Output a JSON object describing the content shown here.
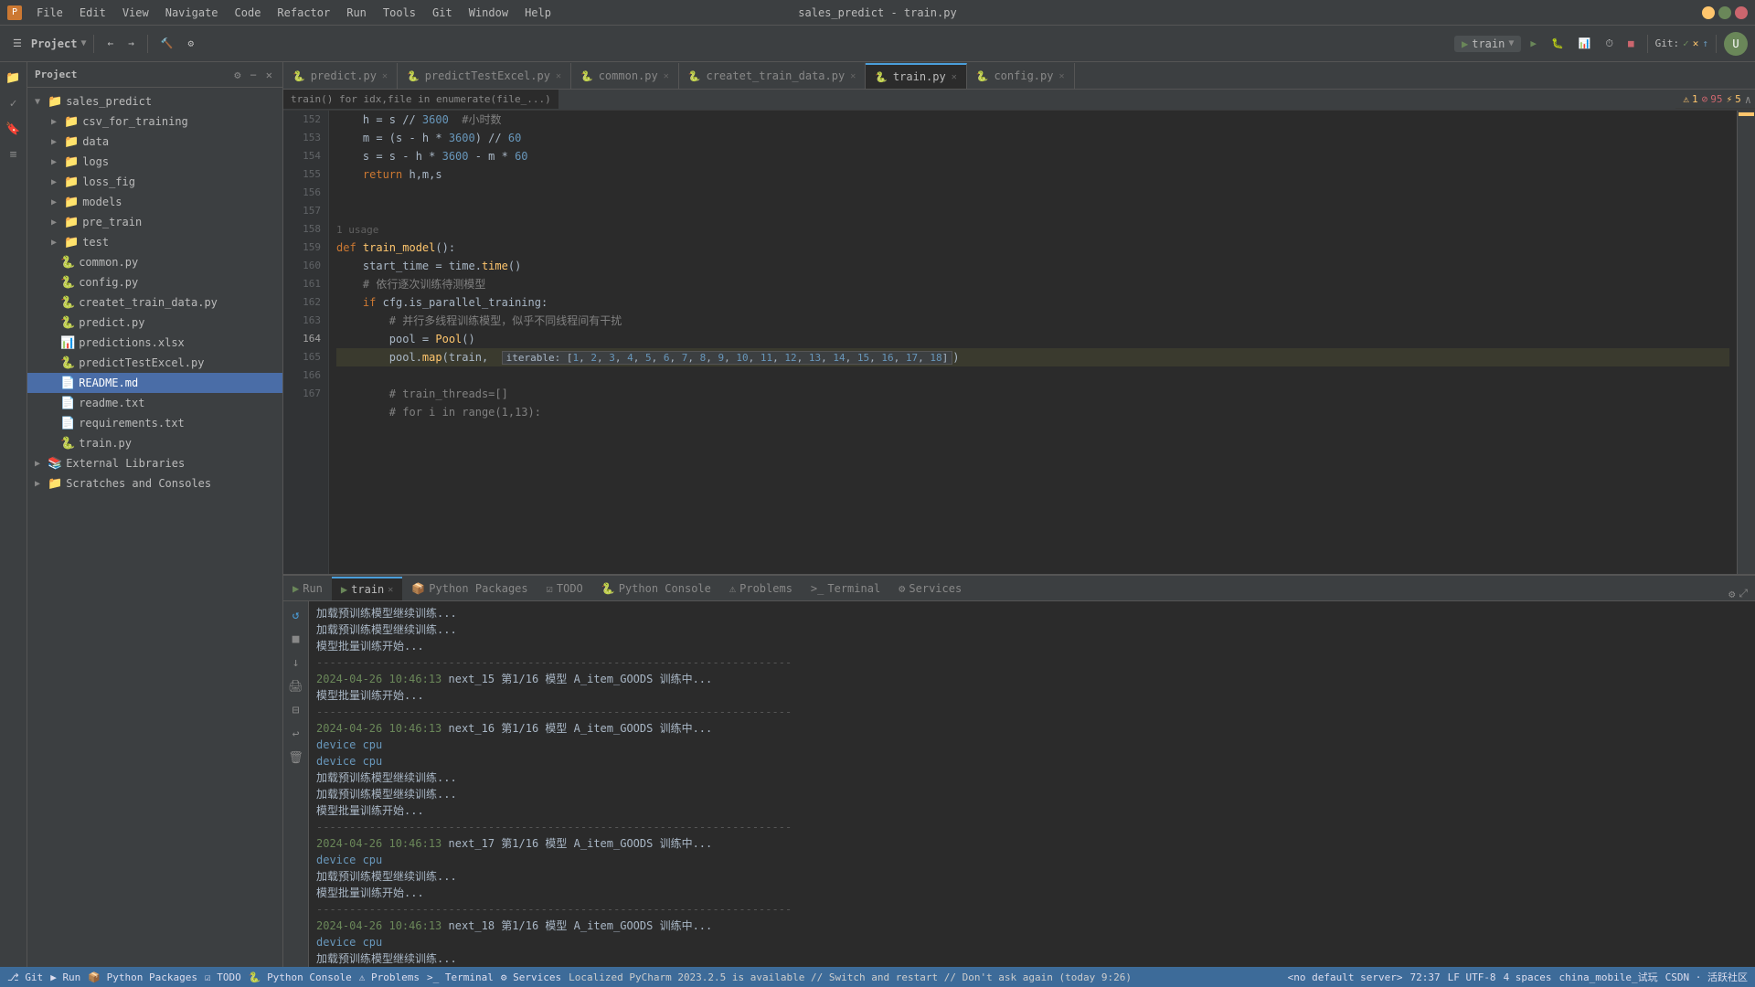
{
  "window": {
    "title": "sales_predict - train.py",
    "min": "—",
    "max": "□",
    "close": "✕"
  },
  "menus": [
    "File",
    "Edit",
    "View",
    "Navigate",
    "Code",
    "Refactor",
    "Run",
    "Tools",
    "Git",
    "Window",
    "Help"
  ],
  "project_name": "sales_predict",
  "active_file": "train.py",
  "toolbar": {
    "project_label": "Project",
    "run_config": "train",
    "git_label": "Git:",
    "git_status": "✓ ✕ ↑"
  },
  "tabs": [
    {
      "label": "predict.py",
      "active": false,
      "modified": false
    },
    {
      "label": "predictTestExcel.py",
      "active": false,
      "modified": false
    },
    {
      "label": "common.py",
      "active": false,
      "modified": false
    },
    {
      "label": "createt_train_data.py",
      "active": false,
      "modified": false
    },
    {
      "label": "train.py",
      "active": true,
      "modified": false
    },
    {
      "label": "config.py",
      "active": false,
      "modified": false
    }
  ],
  "breadcrumb": "train()   for idx,file in enumerate(file_...)",
  "sidebar": {
    "title": "Project",
    "root": "sales_predict",
    "root_path": "D/git/ai/sales_predict",
    "items": [
      {
        "label": "csv_for_training",
        "type": "folder",
        "depth": 1,
        "expanded": false
      },
      {
        "label": "data",
        "type": "folder",
        "depth": 1,
        "expanded": false
      },
      {
        "label": "logs",
        "type": "folder",
        "depth": 1,
        "expanded": false
      },
      {
        "label": "loss_fig",
        "type": "folder",
        "depth": 1,
        "expanded": false
      },
      {
        "label": "models",
        "type": "folder",
        "depth": 1,
        "expanded": false
      },
      {
        "label": "pre_train",
        "type": "folder",
        "depth": 1,
        "expanded": false
      },
      {
        "label": "test",
        "type": "folder",
        "depth": 1,
        "expanded": false
      },
      {
        "label": "common.py",
        "type": "py",
        "depth": 2
      },
      {
        "label": "config.py",
        "type": "py",
        "depth": 2
      },
      {
        "label": "createt_train_data.py",
        "type": "py",
        "depth": 2
      },
      {
        "label": "predict.py",
        "type": "py",
        "depth": 2
      },
      {
        "label": "predictions.xlsx",
        "type": "xlsx",
        "depth": 2
      },
      {
        "label": "predictTestExcel.py",
        "type": "py",
        "depth": 2
      },
      {
        "label": "README.md",
        "type": "md",
        "depth": 2,
        "selected": true
      },
      {
        "label": "readme.txt",
        "type": "txt",
        "depth": 2
      },
      {
        "label": "requirements.txt",
        "type": "txt",
        "depth": 2
      },
      {
        "label": "train.py",
        "type": "py",
        "depth": 2
      },
      {
        "label": "External Libraries",
        "type": "folder",
        "depth": 0
      },
      {
        "label": "Scratches and Consoles",
        "type": "folder",
        "depth": 0
      }
    ]
  },
  "code_lines": [
    {
      "num": 152,
      "text": "    h = s // 3600  #小时数",
      "tokens": [
        {
          "t": "var",
          "v": "    h = s // 3600  "
        },
        {
          "t": "cm",
          "v": "#小时数"
        }
      ]
    },
    {
      "num": 153,
      "text": "    m = (s - h * 3600) // 60",
      "tokens": [
        {
          "t": "var",
          "v": "    m = (s - h * "
        },
        {
          "t": "num",
          "v": "3600"
        },
        {
          "t": "var",
          "v": ") // "
        },
        {
          "t": "num",
          "v": "60"
        }
      ]
    },
    {
      "num": 154,
      "text": "    s = s - h * 3600 - m * 60",
      "tokens": [
        {
          "t": "var",
          "v": "    s = s - h * "
        },
        {
          "t": "num",
          "v": "3600"
        },
        {
          "t": "var",
          "v": " - m * "
        },
        {
          "t": "num",
          "v": "60"
        }
      ]
    },
    {
      "num": 155,
      "text": "    return h,m,s",
      "tokens": [
        {
          "t": "kw",
          "v": "    return "
        },
        {
          "t": "var",
          "v": "h,m,s"
        }
      ]
    },
    {
      "num": 156,
      "text": "",
      "tokens": []
    },
    {
      "num": 157,
      "text": "",
      "tokens": []
    },
    {
      "num": 158,
      "text": "1 usage\ndef train_model():",
      "tokens": [
        {
          "t": "cm",
          "v": "1 usage"
        },
        {
          "t": "kw",
          "v": "\ndef "
        },
        {
          "t": "fn",
          "v": "train_model"
        },
        {
          "t": "var",
          "v": "():"
        }
      ]
    },
    {
      "num": 159,
      "text": "    start_time = time.time()",
      "tokens": [
        {
          "t": "var",
          "v": "    start_time = time."
        },
        {
          "t": "fn",
          "v": "time"
        },
        {
          "t": "var",
          "v": "()"
        }
      ]
    },
    {
      "num": 160,
      "text": "    # 依行逐次训练待测模型",
      "tokens": [
        {
          "t": "cm",
          "v": "    # 依行逐次训练待测模型"
        }
      ]
    },
    {
      "num": 161,
      "text": "    if cfg.is_parallel_training:",
      "tokens": [
        {
          "t": "var",
          "v": "    "
        },
        {
          "t": "kw",
          "v": "if "
        },
        {
          "t": "var",
          "v": "cfg.is_parallel_training:"
        }
      ]
    },
    {
      "num": 162,
      "text": "        # 并行多线程训练模型，似乎不同线程间有干扰",
      "tokens": [
        {
          "t": "cm",
          "v": "        # 并行多线程训练模型，似乎不同线程间有干扰"
        }
      ]
    },
    {
      "num": 163,
      "text": "        pool = Pool()",
      "tokens": [
        {
          "t": "var",
          "v": "        pool = "
        },
        {
          "t": "fn",
          "v": "Pool"
        },
        {
          "t": "var",
          "v": "()"
        }
      ]
    },
    {
      "num": 164,
      "text": "        pool.map(train,  iterable: [1, 2, 3, 4, 5, 6, 7, 8, 9, 10, 11, 12, 13, 14, 15, 16, 17, 18])",
      "tokens": [
        {
          "t": "var",
          "v": "        pool."
        },
        {
          "t": "fn",
          "v": "map"
        },
        {
          "t": "var",
          "v": "(train,  "
        },
        {
          "t": "cm",
          "v": "iterable: "
        },
        {
          "t": "var",
          "v": "["
        },
        {
          "t": "num",
          "v": "1"
        },
        {
          "t": "var",
          "v": ", "
        },
        {
          "t": "num",
          "v": "2"
        },
        {
          "t": "var",
          "v": ", "
        },
        {
          "t": "num",
          "v": "3"
        },
        {
          "t": "var",
          "v": ", "
        },
        {
          "t": "num",
          "v": "4"
        },
        {
          "t": "var",
          "v": ", "
        },
        {
          "t": "num",
          "v": "5"
        },
        {
          "t": "var",
          "v": ", "
        },
        {
          "t": "num",
          "v": "6"
        },
        {
          "t": "var",
          "v": ", "
        },
        {
          "t": "num",
          "v": "7"
        },
        {
          "t": "var",
          "v": ", "
        },
        {
          "t": "num",
          "v": "8"
        },
        {
          "t": "var",
          "v": ", "
        },
        {
          "t": "num",
          "v": "9"
        },
        {
          "t": "var",
          "v": ", "
        },
        {
          "t": "num",
          "v": "10"
        },
        {
          "t": "var",
          "v": ", "
        },
        {
          "t": "num",
          "v": "11"
        },
        {
          "t": "var",
          "v": ", "
        },
        {
          "t": "num",
          "v": "12"
        },
        {
          "t": "var",
          "v": ", "
        },
        {
          "t": "num",
          "v": "13"
        },
        {
          "t": "var",
          "v": ", "
        },
        {
          "t": "num",
          "v": "14"
        },
        {
          "t": "var",
          "v": ", "
        },
        {
          "t": "num",
          "v": "15"
        },
        {
          "t": "var",
          "v": ", "
        },
        {
          "t": "num",
          "v": "16"
        },
        {
          "t": "var",
          "v": ", "
        },
        {
          "t": "num",
          "v": "17"
        },
        {
          "t": "var",
          "v": ", "
        },
        {
          "t": "num",
          "v": "18"
        },
        {
          "t": "var",
          "v": "])"
        }
      ]
    },
    {
      "num": 165,
      "text": "",
      "tokens": []
    },
    {
      "num": 166,
      "text": "        # train_threads=[]",
      "tokens": [
        {
          "t": "cm",
          "v": "        # train_threads=[]"
        }
      ]
    },
    {
      "num": 167,
      "text": "        # for i in range(1,13):",
      "tokens": [
        {
          "t": "cm",
          "v": "        # for i in range(1,13):"
        }
      ]
    }
  ],
  "warnings": {
    "count": 1,
    "errors": 95,
    "warnings2": 5
  },
  "bottom_tabs": [
    {
      "label": "Run",
      "icon": "▶",
      "active": false
    },
    {
      "label": "train",
      "icon": "▶",
      "active": true
    },
    {
      "label": "Python Packages",
      "icon": "📦",
      "active": false
    },
    {
      "label": "TODO",
      "icon": "☑",
      "active": false
    },
    {
      "label": "Python Console",
      "icon": "🐍",
      "active": false
    },
    {
      "label": "Problems",
      "icon": "⚠",
      "active": false
    },
    {
      "label": "Terminal",
      "icon": ">_",
      "active": false
    },
    {
      "label": "Services",
      "icon": "⚙",
      "active": false
    }
  ],
  "console": {
    "lines": [
      "加载预训练模型继续训练...",
      "加载预训练模型继续训练...",
      "模型批量训练开始...",
      "------------------------------------------------------------------------",
      "2024-04-26 10:46:13 next_15 第1/16 模型 A_item_GOODS 训练中...",
      "模型批量训练开始...",
      "------------------------------------------------------------------------",
      "2024-04-26 10:46:13 next_16 第1/16 模型 A_item_GOODS 训练中...",
      "device cpu",
      "device cpu",
      "加载预训练模型继续训练...",
      "加载预训练模型继续训练...",
      "模型批量训练开始...",
      "------------------------------------------------------------------------",
      "2024-04-26 10:46:13 next_17 第1/16 模型 A_item_GOODS 训练中...",
      "device cpu",
      "加载预训练模型继续训练...",
      "模型批量训练开始...",
      "------------------------------------------------------------------------",
      "2024-04-26 10:46:13 next_18 第1/16 模型 A_item_GOODS 训练中...",
      "device cpu",
      "加载预训练模型继续训练..."
    ]
  },
  "status_bar": {
    "git_label": "Git",
    "run_label": "Run",
    "python_packages": "Python Packages",
    "todo": "TODO",
    "python_console": "Python Console",
    "problems": "Problems",
    "terminal": "Terminal",
    "services": "Services",
    "notification": "Localized PyCharm 2023.2.5 is available // Switch and restart // Don't ask again (today 9:26)",
    "line_col": "72:37",
    "encoding": "LF  UTF-8",
    "indent": "4 spaces",
    "branch": "china_mobile_试玩",
    "csdn": "CSDN · 活跃社区",
    "no_server": "<no default server>"
  }
}
